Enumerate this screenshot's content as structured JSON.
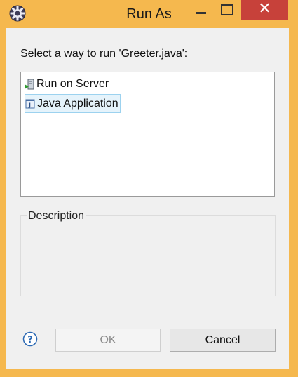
{
  "window": {
    "title": "Run As",
    "close_glyph": "✕"
  },
  "dialog": {
    "prompt": "Select a way to run 'Greeter.java':",
    "options": [
      {
        "label": "Run on Server",
        "icon": "run-on-server-icon",
        "selected": false
      },
      {
        "label": "Java Application",
        "icon": "java-application-icon",
        "selected": true
      }
    ],
    "description_label": "Description",
    "description_text": ""
  },
  "buttons": {
    "ok": "OK",
    "cancel": "Cancel",
    "help_icon": "help-icon"
  },
  "colors": {
    "frame": "#f5b84e",
    "close": "#c7413a",
    "selection_fill": "#e5f3fb",
    "selection_border": "#9cd2ef",
    "help_blue": "#2a68b3"
  }
}
